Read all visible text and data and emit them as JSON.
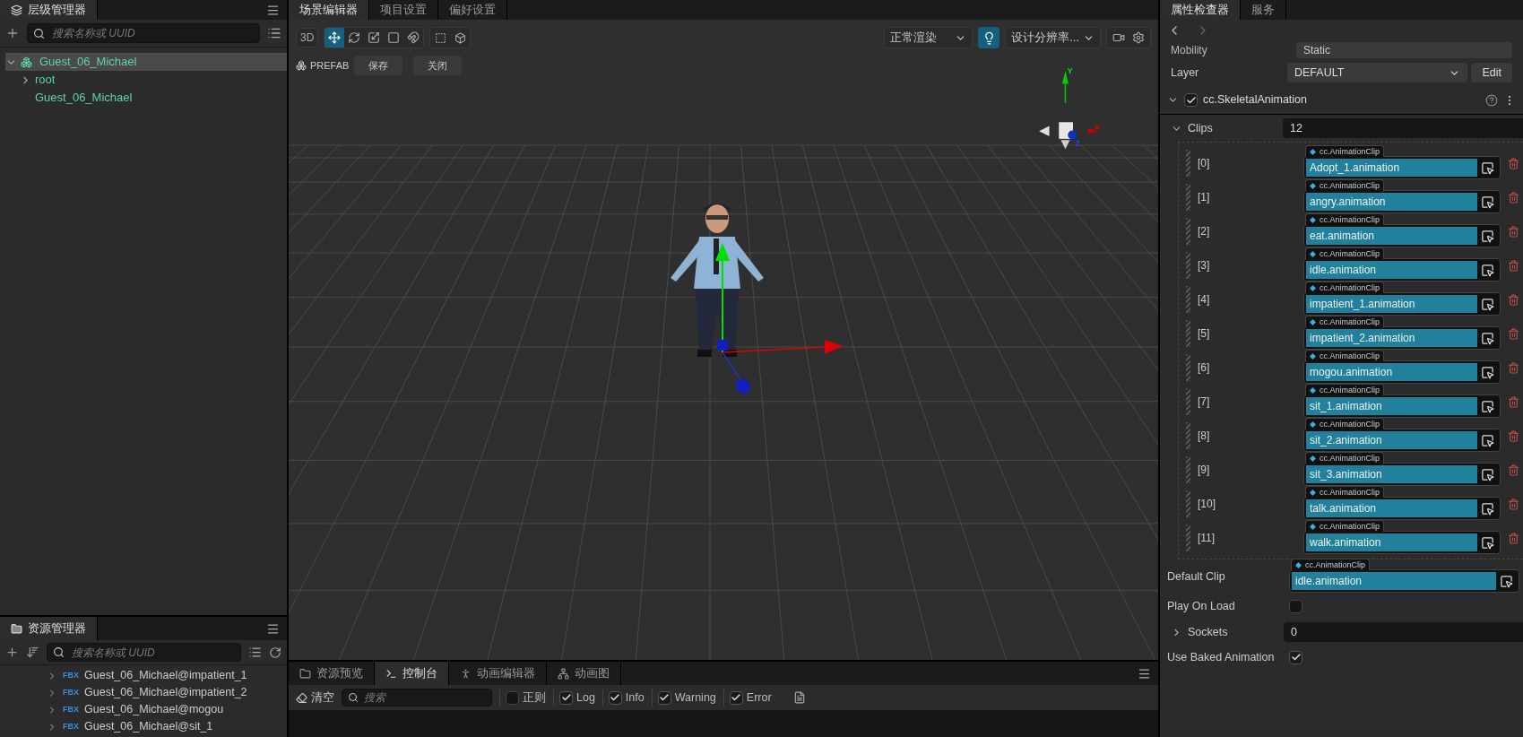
{
  "hierarchy": {
    "tab": "层级管理器",
    "search_placeholder": "搜索名称或 UUID",
    "tree": [
      {
        "label": "Guest_06_Michael",
        "kind": "prefab",
        "expanded": true,
        "selected": true,
        "children": [
          {
            "label": "root",
            "kind": "branch",
            "expanded": false,
            "selected": false
          },
          {
            "label": "Guest_06_Michael",
            "kind": "leaf",
            "selected": false
          }
        ]
      }
    ]
  },
  "assets": {
    "tab": "资源管理器",
    "search_placeholder": "搜索名称或 UUID",
    "items": [
      {
        "badge": "FBX",
        "label": "Guest_06_Michael@impatient_1",
        "expanded": false
      },
      {
        "badge": "FBX",
        "label": "Guest_06_Michael@impatient_2",
        "expanded": false
      },
      {
        "badge": "FBX",
        "label": "Guest_06_Michael@mogou",
        "expanded": false
      },
      {
        "badge": "FBX",
        "label": "Guest_06_Michael@sit_1",
        "expanded": false
      }
    ]
  },
  "scene": {
    "tabs": [
      {
        "label": "场景编辑器",
        "selected": true
      },
      {
        "label": "项目设置",
        "selected": false
      },
      {
        "label": "偏好设置",
        "selected": false
      }
    ],
    "mode_button": "3D",
    "tools": [
      {
        "kind": "move",
        "selected": true
      },
      {
        "kind": "rotate",
        "selected": false
      },
      {
        "kind": "scale",
        "selected": false
      },
      {
        "kind": "rect",
        "selected": false
      },
      {
        "kind": "snap",
        "selected": false
      }
    ],
    "prefab_label": "PREFAB",
    "prefab_buttons": [
      "保存",
      "关闭"
    ],
    "render_mode": "正常渲染",
    "light_on": true,
    "resolution": "设计分辨率...",
    "axis_labels": [
      "Y",
      "X",
      "Z"
    ]
  },
  "console": {
    "tabs": [
      {
        "label": "资源预览",
        "kind": "folder",
        "selected": false
      },
      {
        "label": "控制台",
        "kind": "terminal",
        "selected": true
      },
      {
        "label": "动画编辑器",
        "kind": "runner",
        "selected": false
      },
      {
        "label": "动画图",
        "kind": "graph",
        "selected": false
      }
    ],
    "clear": "清空",
    "search_placeholder": "搜索",
    "filters": [
      {
        "label": "正则",
        "checked": false
      },
      {
        "label": "Log",
        "checked": true
      },
      {
        "label": "Info",
        "checked": true
      },
      {
        "label": "Warning",
        "checked": true
      },
      {
        "label": "Error",
        "checked": true
      }
    ]
  },
  "inspector": {
    "tabs": [
      {
        "label": "属性检查器",
        "selected": true
      },
      {
        "label": "服务",
        "selected": false
      }
    ],
    "mobility": {
      "label": "Mobility",
      "value": "Static"
    },
    "layer": {
      "label": "Layer",
      "value": "DEFAULT",
      "button": "Edit"
    },
    "component": {
      "name": "cc.SkeletalAnimation",
      "enabled": true,
      "expanded": true
    },
    "clips": {
      "label": "Clips",
      "count": "12",
      "expanded": true,
      "items": [
        {
          "index": "[0]",
          "type": "cc.AnimationClip",
          "value": "Adopt_1.animation"
        },
        {
          "index": "[1]",
          "type": "cc.AnimationClip",
          "value": "angry.animation"
        },
        {
          "index": "[2]",
          "type": "cc.AnimationClip",
          "value": "eat.animation"
        },
        {
          "index": "[3]",
          "type": "cc.AnimationClip",
          "value": "idle.animation"
        },
        {
          "index": "[4]",
          "type": "cc.AnimationClip",
          "value": "impatient_1.animation"
        },
        {
          "index": "[5]",
          "type": "cc.AnimationClip",
          "value": "impatient_2.animation"
        },
        {
          "index": "[6]",
          "type": "cc.AnimationClip",
          "value": "mogou.animation"
        },
        {
          "index": "[7]",
          "type": "cc.AnimationClip",
          "value": "sit_1.animation"
        },
        {
          "index": "[8]",
          "type": "cc.AnimationClip",
          "value": "sit_2.animation"
        },
        {
          "index": "[9]",
          "type": "cc.AnimationClip",
          "value": "sit_3.animation"
        },
        {
          "index": "[10]",
          "type": "cc.AnimationClip",
          "value": "talk.animation"
        },
        {
          "index": "[11]",
          "type": "cc.AnimationClip",
          "value": "walk.animation"
        }
      ]
    },
    "default_clip": {
      "label": "Default Clip",
      "type": "cc.AnimationClip",
      "value": "idle.animation"
    },
    "play_on_load": {
      "label": "Play On Load",
      "checked": false
    },
    "sockets": {
      "label": "Sockets",
      "value": "0",
      "expanded": false
    },
    "use_baked": {
      "label": "Use Baked Animation",
      "checked": true
    }
  }
}
